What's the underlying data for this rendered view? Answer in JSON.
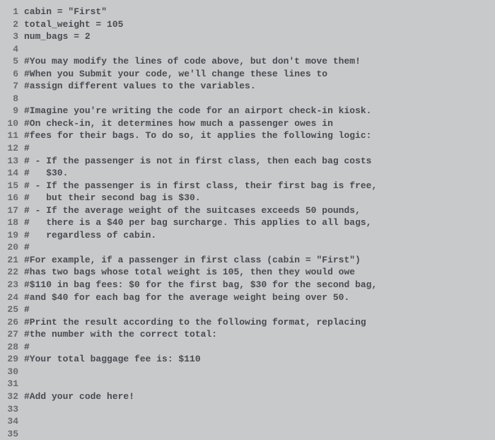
{
  "chart_data": null,
  "code": {
    "lines": [
      {
        "n": 1,
        "text": "cabin = \"First\""
      },
      {
        "n": 2,
        "text": "total_weight = 105"
      },
      {
        "n": 3,
        "text": "num_bags = 2"
      },
      {
        "n": 4,
        "text": ""
      },
      {
        "n": 5,
        "text": "#You may modify the lines of code above, but don't move them!"
      },
      {
        "n": 6,
        "text": "#When you Submit your code, we'll change these lines to"
      },
      {
        "n": 7,
        "text": "#assign different values to the variables."
      },
      {
        "n": 8,
        "text": ""
      },
      {
        "n": 9,
        "text": "#Imagine you're writing the code for an airport check-in kiosk."
      },
      {
        "n": 10,
        "text": "#On check-in, it determines how much a passenger owes in"
      },
      {
        "n": 11,
        "text": "#fees for their bags. To do so, it applies the following logic:"
      },
      {
        "n": 12,
        "text": "#"
      },
      {
        "n": 13,
        "text": "# - If the passenger is not in first class, then each bag costs"
      },
      {
        "n": 14,
        "text": "#   $30."
      },
      {
        "n": 15,
        "text": "# - If the passenger is in first class, their first bag is free,"
      },
      {
        "n": 16,
        "text": "#   but their second bag is $30."
      },
      {
        "n": 17,
        "text": "# - If the average weight of the suitcases exceeds 50 pounds,"
      },
      {
        "n": 18,
        "text": "#   there is a $40 per bag surcharge. This applies to all bags,"
      },
      {
        "n": 19,
        "text": "#   regardless of cabin."
      },
      {
        "n": 20,
        "text": "#"
      },
      {
        "n": 21,
        "text": "#For example, if a passenger in first class (cabin = \"First\")"
      },
      {
        "n": 22,
        "text": "#has two bags whose total weight is 105, then they would owe"
      },
      {
        "n": 23,
        "text": "#$110 in bag fees: $0 for the first bag, $30 for the second bag,"
      },
      {
        "n": 24,
        "text": "#and $40 for each bag for the average weight being over 50."
      },
      {
        "n": 25,
        "text": "#"
      },
      {
        "n": 26,
        "text": "#Print the result according to the following format, replacing"
      },
      {
        "n": 27,
        "text": "#the number with the correct total:"
      },
      {
        "n": 28,
        "text": "#"
      },
      {
        "n": 29,
        "text": "#Your total baggage fee is: $110"
      },
      {
        "n": 30,
        "text": ""
      },
      {
        "n": 31,
        "text": ""
      },
      {
        "n": 32,
        "text": "#Add your code here!"
      },
      {
        "n": 33,
        "text": ""
      },
      {
        "n": 34,
        "text": ""
      },
      {
        "n": 35,
        "text": ""
      }
    ]
  }
}
